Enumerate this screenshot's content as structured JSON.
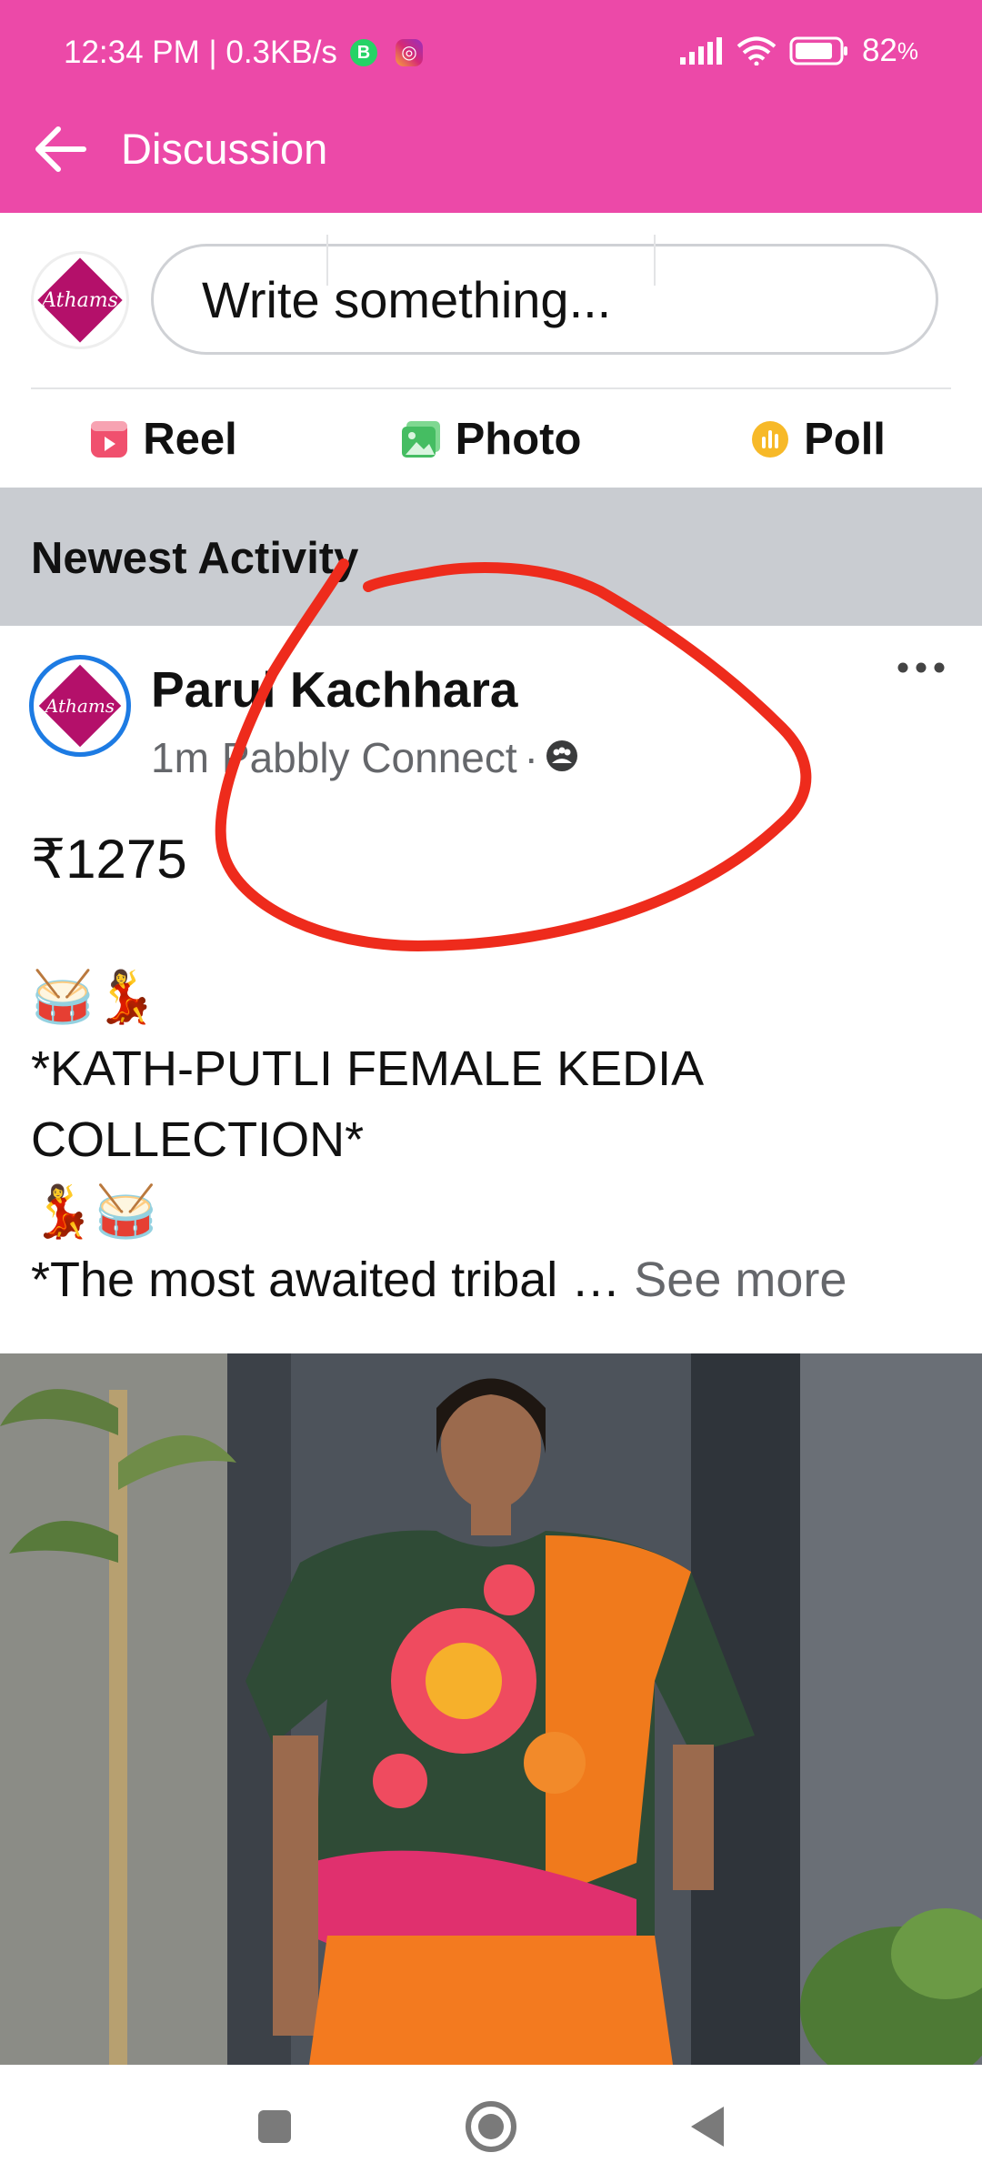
{
  "status_bar": {
    "time_info": "12:34 PM | 0.3KB/s",
    "battery": "82",
    "battery_unit": "%"
  },
  "app_bar": {
    "title": "Discussion"
  },
  "composer": {
    "placeholder": "Write something...",
    "avatar_text": "Athams",
    "actions": [
      {
        "label": "Reel",
        "icon": "reel-icon",
        "color": "#f0506e"
      },
      {
        "label": "Photo",
        "icon": "photo-icon",
        "color": "#45bd62"
      },
      {
        "label": "Poll",
        "icon": "poll-icon",
        "color": "#f7b928"
      }
    ]
  },
  "section": {
    "title": "Newest Activity"
  },
  "post": {
    "author": "Parul Kachhara",
    "time": "1m",
    "source": "Pabbly Connect",
    "separator": "·",
    "audience_icon": "group-icon",
    "price": "₹1275",
    "emoji_line_1": "🥁💃",
    "text_line_1": "*KATH-PUTLI FEMALE KEDIA",
    "text_line_2": "COLLECTION*",
    "emoji_line_2": "💃🥁",
    "text_line_3": "*The most awaited tribal … ",
    "see_more": "See more"
  },
  "colors": {
    "brand_pink": "#ec49a8",
    "section_bg": "#c9ccd1",
    "annotation_red": "#ee2b1c",
    "meta_gray": "#65676b"
  }
}
